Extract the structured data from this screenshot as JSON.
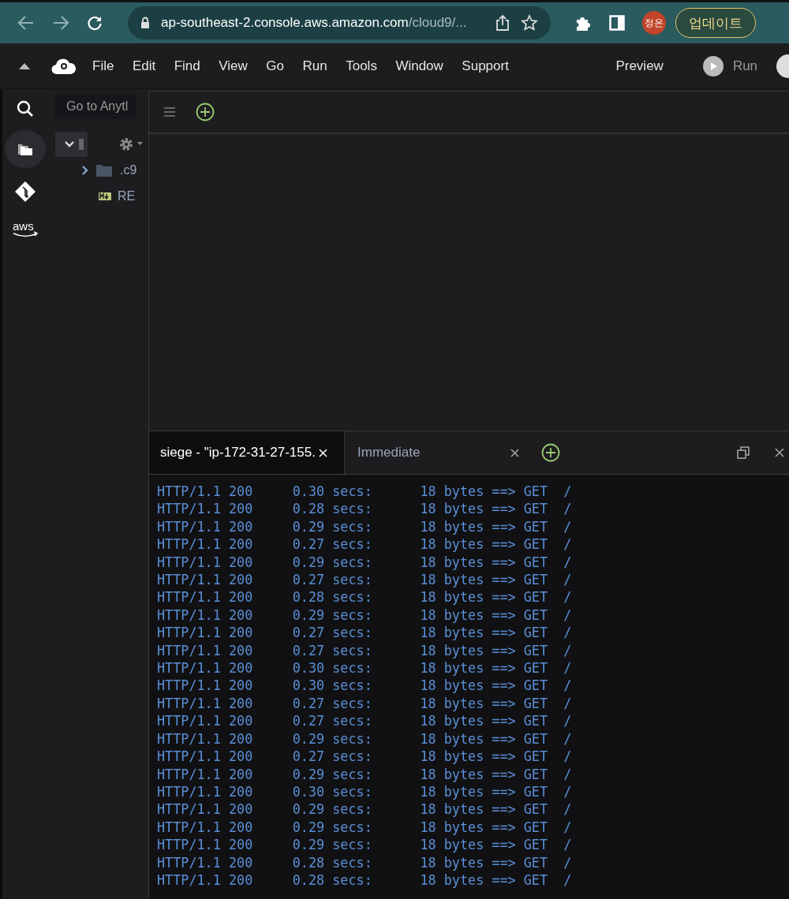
{
  "browser": {
    "url_host": "ap-southeast-2.console.aws.amazon.com",
    "url_path": "/cloud9/...",
    "profile": "정온",
    "update_button": "업데이트"
  },
  "menu_bar": {
    "items": [
      "File",
      "Edit",
      "Find",
      "View",
      "Go",
      "Run",
      "Tools",
      "Window",
      "Support"
    ],
    "preview": "Preview",
    "run": "Run"
  },
  "rail": {
    "logo_text": "aws"
  },
  "sidebar": {
    "search_placeholder": "Go to Anytl",
    "tree": [
      {
        "label": ".c9",
        "kind": "folder",
        "expanded": false
      },
      {
        "label": "RE",
        "kind": "markdown"
      }
    ]
  },
  "terminal": {
    "tabs": [
      {
        "label": "siege - \"ip-172-31-27-155.",
        "selected": true
      },
      {
        "label": "Immediate",
        "selected": false
      }
    ],
    "lines": [
      "HTTP/1.1 200     0.30 secs:      18 bytes ==> GET  /",
      "HTTP/1.1 200     0.28 secs:      18 bytes ==> GET  /",
      "HTTP/1.1 200     0.29 secs:      18 bytes ==> GET  /",
      "HTTP/1.1 200     0.27 secs:      18 bytes ==> GET  /",
      "HTTP/1.1 200     0.29 secs:      18 bytes ==> GET  /",
      "HTTP/1.1 200     0.27 secs:      18 bytes ==> GET  /",
      "HTTP/1.1 200     0.28 secs:      18 bytes ==> GET  /",
      "HTTP/1.1 200     0.29 secs:      18 bytes ==> GET  /",
      "HTTP/1.1 200     0.27 secs:      18 bytes ==> GET  /",
      "HTTP/1.1 200     0.27 secs:      18 bytes ==> GET  /",
      "HTTP/1.1 200     0.30 secs:      18 bytes ==> GET  /",
      "HTTP/1.1 200     0.30 secs:      18 bytes ==> GET  /",
      "HTTP/1.1 200     0.27 secs:      18 bytes ==> GET  /",
      "HTTP/1.1 200     0.27 secs:      18 bytes ==> GET  /",
      "HTTP/1.1 200     0.29 secs:      18 bytes ==> GET  /",
      "HTTP/1.1 200     0.27 secs:      18 bytes ==> GET  /",
      "HTTP/1.1 200     0.29 secs:      18 bytes ==> GET  /",
      "HTTP/1.1 200     0.30 secs:      18 bytes ==> GET  /",
      "HTTP/1.1 200     0.29 secs:      18 bytes ==> GET  /",
      "HTTP/1.1 200     0.29 secs:      18 bytes ==> GET  /",
      "HTTP/1.1 200     0.29 secs:      18 bytes ==> GET  /",
      "HTTP/1.1 200     0.28 secs:      18 bytes ==> GET  /",
      "HTTP/1.1 200     0.28 secs:      18 bytes ==> GET  /"
    ]
  }
}
